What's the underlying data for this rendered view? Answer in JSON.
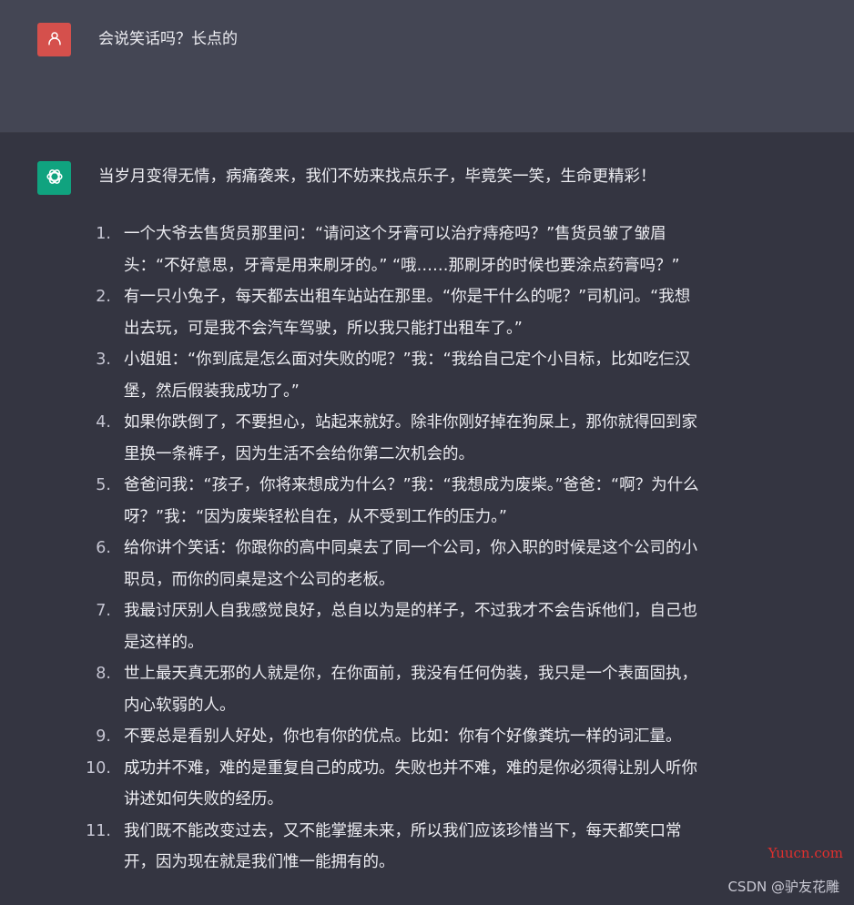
{
  "user_message": {
    "avatar_icon": "user-icon",
    "avatar_color": "#d5504c",
    "text": "会说笑话吗？长点的"
  },
  "assistant_message": {
    "avatar_icon": "openai-logo-icon",
    "avatar_color": "#10a37f",
    "intro": "当岁月变得无情，病痛袭来，我们不妨来找点乐子，毕竟笑一笑，生命更精彩！",
    "jokes": [
      {
        "num": "1.",
        "lines": [
          "一个大爷去售货员那里问：“请问这个牙膏可以治疗痔疮吗？”售货员皱了皱眉",
          "头：“不好意思，牙膏是用来刷牙的。” “哦……那刷牙的时候也要涂点药膏吗？”"
        ]
      },
      {
        "num": "2.",
        "lines": [
          "有一只小兔子，每天都去出租车站站在那里。“你是干什么的呢？”司机问。“我想",
          "出去玩，可是我不会汽车驾驶，所以我只能打出租车了。”"
        ]
      },
      {
        "num": "3.",
        "lines": [
          "小姐姐：“你到底是怎么面对失败的呢？”我：“我给自己定个小目标，比如吃仨汉",
          "堡，然后假装我成功了。”"
        ]
      },
      {
        "num": "4.",
        "lines": [
          "如果你跌倒了，不要担心，站起来就好。除非你刚好掉在狗屎上，那你就得回到家",
          "里换一条裤子，因为生活不会给你第二次机会的。"
        ]
      },
      {
        "num": "5.",
        "lines": [
          "爸爸问我：“孩子，你将来想成为什么？”我：“我想成为废柴。”爸爸：“啊？为什么",
          "呀？”我：“因为废柴轻松自在，从不受到工作的压力。”"
        ]
      },
      {
        "num": "6.",
        "lines": [
          "给你讲个笑话：你跟你的高中同桌去了同一个公司，你入职的时候是这个公司的小",
          "职员，而你的同桌是这个公司的老板。"
        ]
      },
      {
        "num": "7.",
        "lines": [
          "我最讨厌别人自我感觉良好，总自以为是的样子，不过我才不会告诉他们，自己也",
          "是这样的。"
        ]
      },
      {
        "num": "8.",
        "lines": [
          "世上最天真无邪的人就是你，在你面前，我没有任何伪装，我只是一个表面固执，",
          "内心软弱的人。"
        ]
      },
      {
        "num": "9.",
        "lines": [
          "不要总是看别人好处，你也有你的优点。比如：你有个好像粪坑一样的词汇量。"
        ]
      },
      {
        "num": "10.",
        "lines": [
          "成功并不难，难的是重复自己的成功。失败也并不难，难的是你必须得让别人听你",
          "讲述如何失败的经历。"
        ]
      },
      {
        "num": "11.",
        "lines": [
          "我们既不能改变过去，又不能掌握未来，所以我们应该珍惜当下，每天都笑口常",
          "开，因为现在就是我们惟一能拥有的。"
        ]
      }
    ]
  },
  "watermarks": {
    "site": "Yuucn.com",
    "csdn": "CSDN @驴友花雕"
  }
}
